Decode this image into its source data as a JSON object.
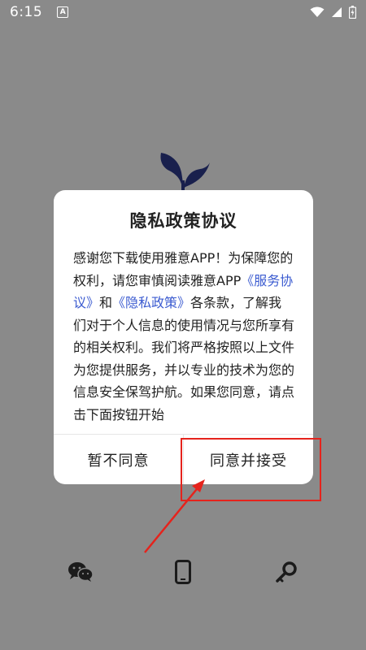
{
  "status_bar": {
    "time": "6:15",
    "notification_icon_letter": "A"
  },
  "dialog": {
    "title": "隐私政策协议",
    "body": {
      "intro": "感谢您下载使用雅意APP！为保障您的权利，请您审慎阅读雅意APP",
      "service_link": "《服务协议》",
      "and": "和",
      "privacy_link": "《隐私政策》",
      "rest": "各条款，了解我们对于个人信息的使用情况与您所享有的相关权利。我们将严格按照以上文件为您提供服务，并以专业的技术为您的信息安全保驾护航。如果您同意，请点击下面按钮开始"
    },
    "decline_label": "暂不同意",
    "accept_label": "同意并接受"
  },
  "bottom_icons": [
    "wechat-icon",
    "phone-icon",
    "key-icon"
  ],
  "colors": {
    "logo": "#2f3c8f",
    "link": "#3b5bd0",
    "annotation": "#e5231c"
  }
}
